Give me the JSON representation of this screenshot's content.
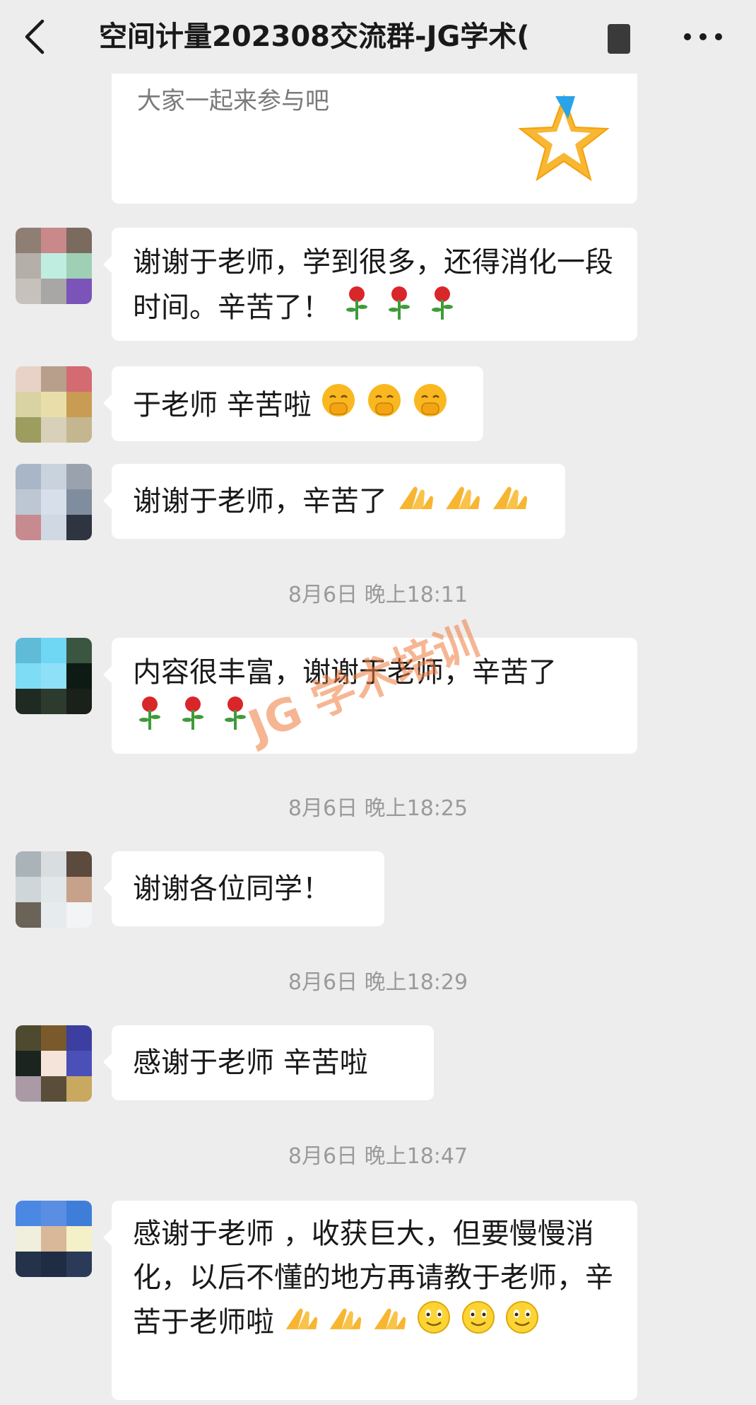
{
  "header": {
    "title": "空间计量202308交流群-JG学术(",
    "back_icon": "chevron-left-icon",
    "more_icon": "more-dots-icon"
  },
  "messages": [
    {
      "text": "大家一起来参与吧"
    },
    {
      "text": "谢谢于老师，学到很多，还得消化一段时间。辛苦了！"
    },
    {
      "text": "于老师  辛苦啦"
    },
    {
      "text": "谢谢于老师，辛苦了"
    },
    {
      "text": "内容很丰富，谢谢于老师，辛苦了"
    },
    {
      "text": "谢谢各位同学！"
    },
    {
      "text": "感谢于老师  辛苦啦"
    },
    {
      "text": "感谢于老师 ，收获巨大，但要慢慢消化，以后不懂的地方再请教于老师，辛苦于老师啦"
    }
  ],
  "timestamps": [
    "8月6日  晚上18:11",
    "8月6日  晚上18:25",
    "8月6日  晚上18:29",
    "8月6日  晚上18:47"
  ],
  "watermark": {
    "logo": "JG",
    "text": "学术培训"
  },
  "colors": {
    "background": "#ededed",
    "bubble": "#ffffff",
    "watermark": "#f07c3c"
  }
}
